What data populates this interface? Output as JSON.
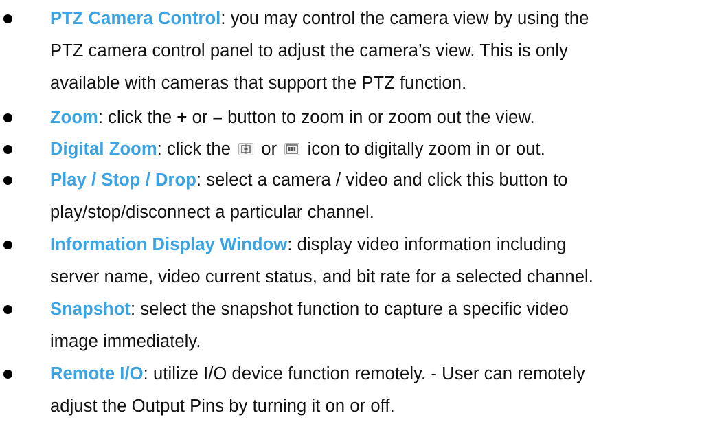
{
  "items": [
    {
      "term": "PTZ Camera Control",
      "line1": ": you may control the camera view by using the",
      "line2": "PTZ camera control panel to adjust the camera’s view. This is only",
      "line3": "available with cameras that support the PTZ function."
    },
    {
      "term": "Zoom",
      "pre": ": click the ",
      "plus": "+",
      "mid": " or ",
      "minus": "–",
      "post": " button to zoom in or zoom out the view."
    },
    {
      "term": "Digital Zoom",
      "pre": ": click the ",
      "mid": " or ",
      "post": " icon to digitally zoom in or out.",
      "icon1": "digital-zoom-in-icon",
      "icon2": "digital-zoom-out-icon"
    },
    {
      "term": "Play / Stop / Drop",
      "line1": ": select a camera / video and click this button to",
      "line2": "play/stop/disconnect a particular channel."
    },
    {
      "term": "Information Display Window",
      "line1": ": display video information including",
      "line2": "server name, video current status, and bit rate for a selected channel."
    },
    {
      "term": "Snapshot",
      "line1": ": select the snapshot function to capture a specific video",
      "line2": "image immediately."
    },
    {
      "term": "Remote I/O",
      "line1": ": utilize I/O device function remotely. - User can remotely",
      "line2": "adjust the Output Pins by turning it on or off."
    }
  ],
  "colors": {
    "term": "#3aa3e3",
    "text": "#111111",
    "bullet": "#000000"
  }
}
